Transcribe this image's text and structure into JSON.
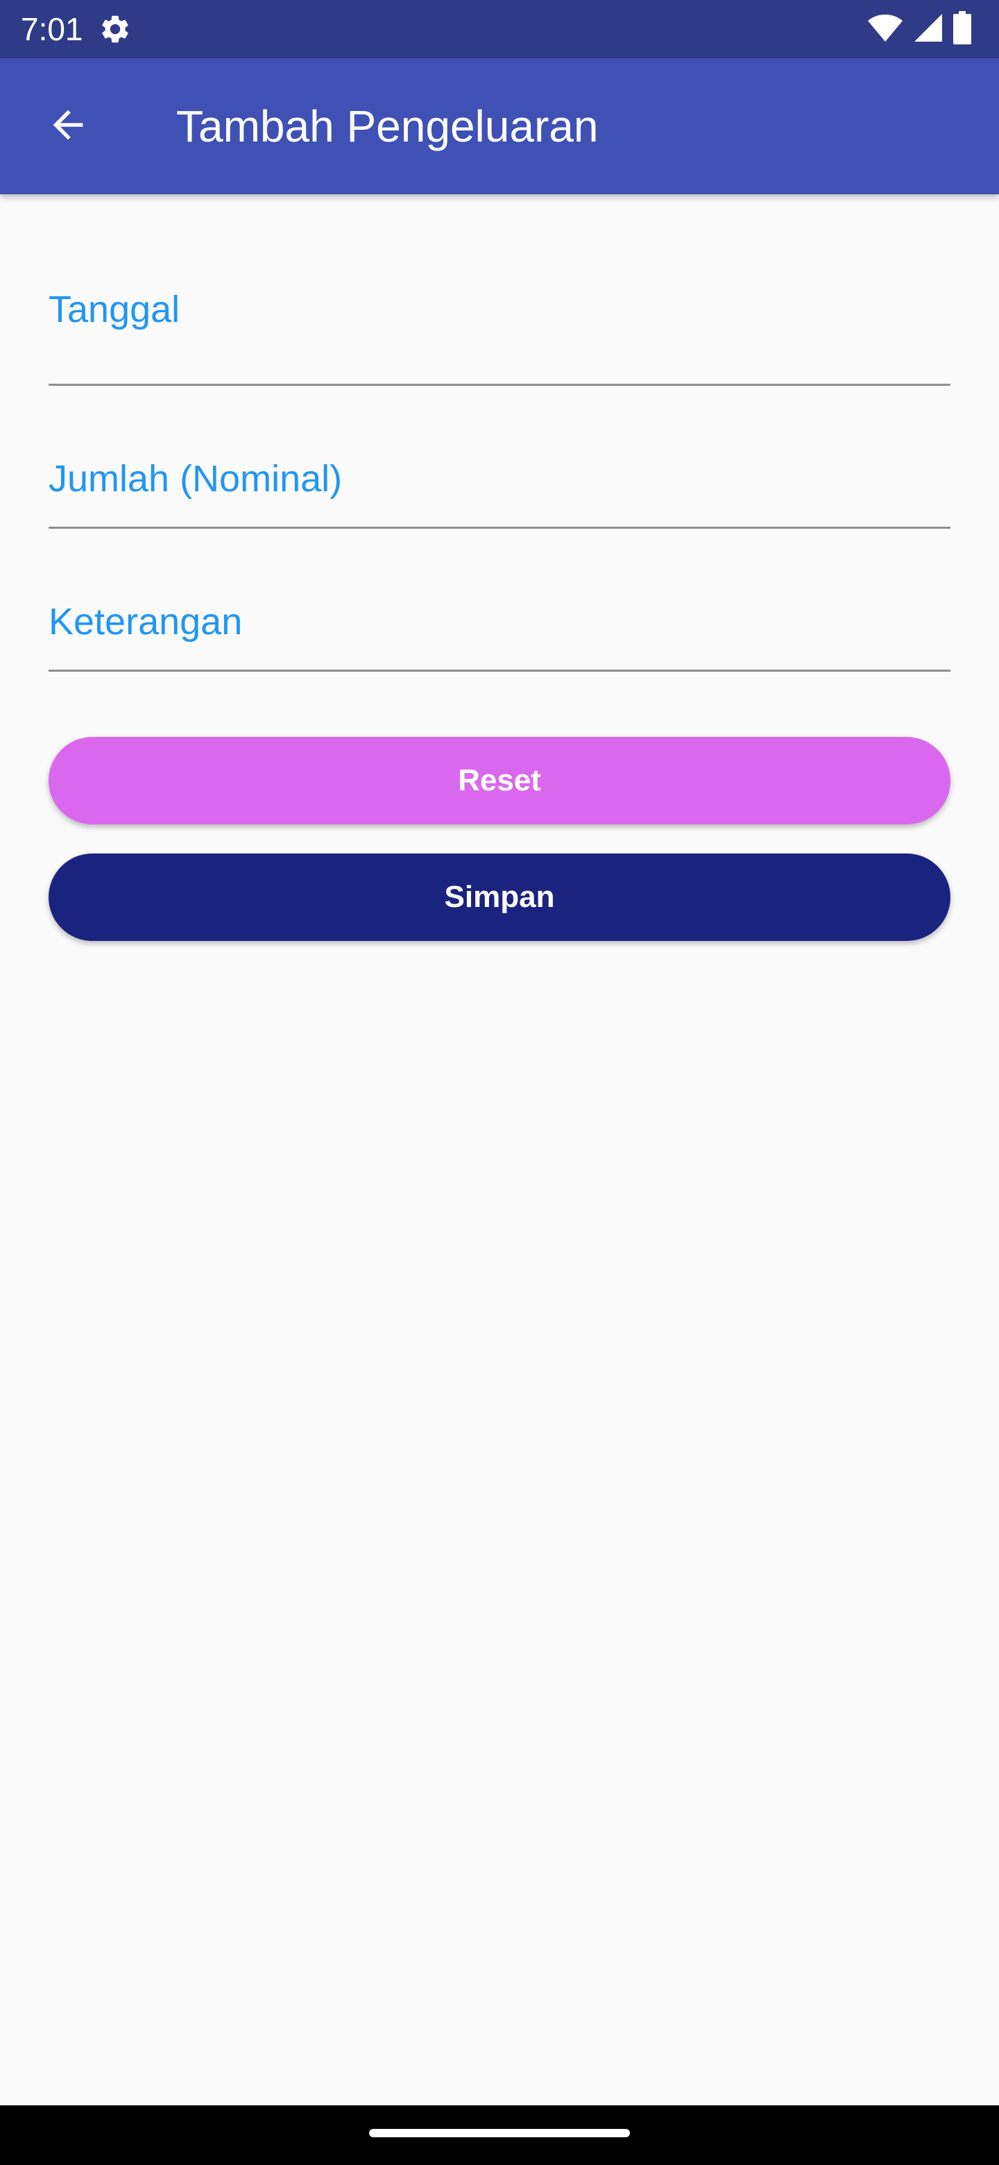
{
  "status_bar": {
    "time": "7:01",
    "icons": [
      "gear-icon",
      "wifi-icon",
      "signal-icon",
      "battery-icon"
    ],
    "background": "#2f3b87"
  },
  "app_bar": {
    "title": "Tambah Pengeluaran",
    "back_icon": "arrow-back-icon",
    "background": "#3f51b5"
  },
  "form": {
    "fields": [
      {
        "label": "Tanggal",
        "value": ""
      },
      {
        "label": "Jumlah (Nominal)",
        "value": ""
      },
      {
        "label": "Keterangan",
        "value": ""
      }
    ],
    "label_color": "#2196f3"
  },
  "buttons": {
    "reset_label": "Reset",
    "reset_color": "#da68ee",
    "save_label": "Simpan",
    "save_color": "#1a237e"
  }
}
